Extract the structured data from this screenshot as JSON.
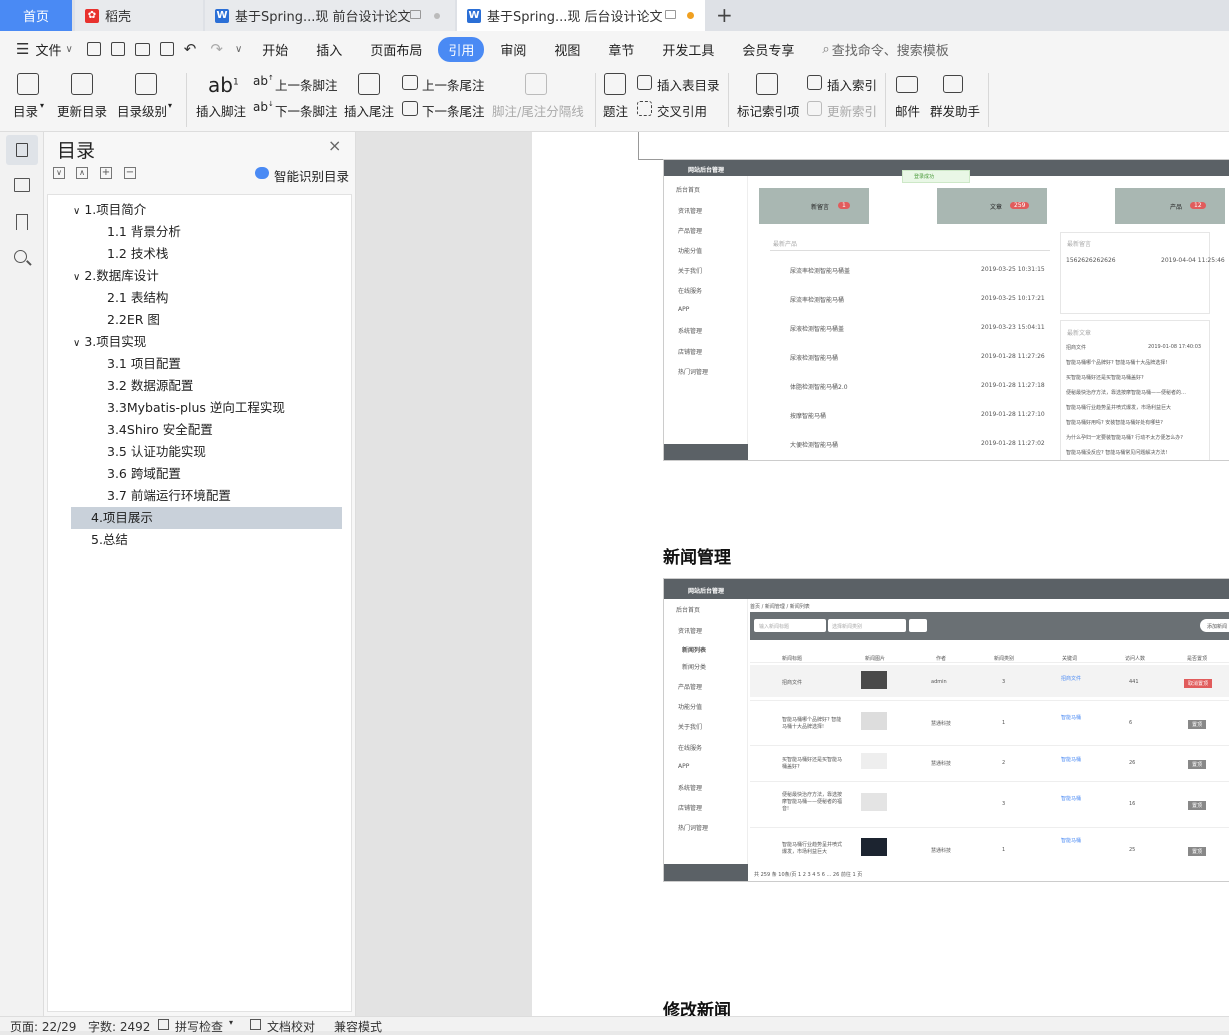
{
  "tabs": {
    "home": "首页",
    "daoke": "稻壳",
    "doc1": "基于Spring...现 前台设计论文",
    "doc2": "基于Spring...现 后台设计论文",
    "new_tab": "+"
  },
  "menu": {
    "file": "文件",
    "items": [
      "开始",
      "插入",
      "页面布局",
      "引用",
      "审阅",
      "视图",
      "章节",
      "开发工具",
      "会员专享"
    ],
    "active": "引用",
    "search": "查找命令、搜索模板"
  },
  "toolbar": {
    "toc": "目录",
    "update_toc": "更新目录",
    "toc_level": "目录级别",
    "insert_footnote": "插入脚注",
    "prev_footnote": "上一条脚注",
    "next_footnote": "下一条脚注",
    "insert_endnote": "插入尾注",
    "prev_endnote": "上一条尾注",
    "next_endnote": "下一条尾注",
    "separator": "脚注/尾注分隔线",
    "caption": "题注",
    "insert_table_toc": "插入表目录",
    "cross_ref": "交叉引用",
    "mark_index": "标记索引项",
    "insert_index": "插入索引",
    "update_index": "更新索引",
    "mail": "邮件",
    "mass_send": "群发助手"
  },
  "toc_panel": {
    "title": "目录",
    "smart": "智能识别目录",
    "items": [
      {
        "label": "1.项目简介",
        "level": 1
      },
      {
        "label": "1.1 背景分析",
        "level": 2
      },
      {
        "label": "1.2 技术栈",
        "level": 2
      },
      {
        "label": "2.数据库设计",
        "level": 1
      },
      {
        "label": "2.1 表结构",
        "level": 2
      },
      {
        "label": "2.2ER 图",
        "level": 2
      },
      {
        "label": "3.项目实现",
        "level": 1
      },
      {
        "label": "3.1 项目配置",
        "level": 2
      },
      {
        "label": "3.2 数据源配置",
        "level": 2
      },
      {
        "label": "3.3Mybatis-plus 逆向工程实现",
        "level": 2
      },
      {
        "label": "3.4Shiro 安全配置",
        "level": 2
      },
      {
        "label": "3.5 认证功能实现",
        "level": 2
      },
      {
        "label": "3.6 跨域配置",
        "level": 2
      },
      {
        "label": "3.7 前端运行环境配置",
        "level": 2
      },
      {
        "label": "4.项目展示",
        "level": 1
      },
      {
        "label": "5.总结",
        "level": 1
      }
    ],
    "selected": "4.项目展示"
  },
  "document": {
    "heading_news": "新闻管理",
    "heading_edit": "修改新闻",
    "shot1": {
      "brand": "网站后台管理",
      "toast": "登录成功",
      "cards": [
        {
          "label": "新留言",
          "count": "1"
        },
        {
          "label": "文章",
          "count": "259"
        },
        {
          "label": "产品",
          "count": "12"
        }
      ],
      "sidebar": [
        "后台首页",
        "资讯管理",
        "产品管理",
        "功能分值",
        "关于我们",
        "在线服务",
        "APP",
        "系统管理",
        "店铺管理",
        "热门词管理"
      ],
      "latest_products_title": "最新产品",
      "products": [
        {
          "name": "尿流率检测智能马桶盖",
          "time": "2019-03-25 10:31:15"
        },
        {
          "name": "尿流率检测智能马桶",
          "time": "2019-03-25 10:17:21"
        },
        {
          "name": "尿液检测智能马桶盖",
          "time": "2019-03-23 15:04:11"
        },
        {
          "name": "尿液检测智能马桶",
          "time": "2019-01-28 11:27:26"
        },
        {
          "name": "体脂检测智能马桶2.0",
          "time": "2019-01-28 11:27:18"
        },
        {
          "name": "按摩智能马桶",
          "time": "2019-01-28 11:27:10"
        },
        {
          "name": "大便检测智能马桶",
          "time": "2019-01-28 11:27:02"
        }
      ],
      "latest_msg_title": "最新留言",
      "msg": {
        "text": "1562626262626",
        "time": "2019-04-04 11:25:46"
      },
      "latest_article_title": "最新文章",
      "articles": [
        {
          "text": "招商文件",
          "time": "2019-01-08 17:40:03"
        },
        {
          "text": "智能马桶哪个品牌好? 智能马桶十大品牌选择!",
          "time": ""
        },
        {
          "text": "买智能马桶好还是买智能马桶盖好?",
          "time": ""
        },
        {
          "text": "便秘最快治疗方法，靠选按摩智能马桶——便秘者的…",
          "time": ""
        },
        {
          "text": "智能马桶行业趋势呈井喷式爆发，市场利益巨大",
          "time": ""
        },
        {
          "text": "智能马桶好用吗? 安装智能马桶好处有哪些?",
          "time": ""
        },
        {
          "text": "为什么孕妇一定要装智能马桶? 行动不太方便怎么办?",
          "time": ""
        },
        {
          "text": "智能马桶没反应? 智能马桶常见问题解决方法!",
          "time": ""
        }
      ]
    },
    "shot2": {
      "brand": "网站后台管理",
      "breadcrumb": "首页 / 新闻管理 / 新闻列表",
      "search_ph1": "输入新闻标题",
      "search_ph2": "选择新闻类别",
      "add_btn": "添加新闻",
      "sidebar": [
        "后台首页",
        "资讯管理",
        "新闻列表",
        "新闻分类",
        "产品管理",
        "功能分值",
        "关于我们",
        "在线服务",
        "APP",
        "系统管理",
        "店铺管理",
        "热门词管理"
      ],
      "columns": [
        "新闻标题",
        "新闻图片",
        "作者",
        "新闻类别",
        "关键词",
        "访问人数",
        "是否置顶"
      ],
      "rows": [
        {
          "title": "招商文件",
          "author": "admin",
          "cat": "3",
          "kw": "招商文件",
          "views": "441",
          "btn": "取消置顶"
        },
        {
          "title": "智能马桶哪个品牌好? 智能马桶十大品牌选择!",
          "author": "慧通科技",
          "cat": "1",
          "kw": "智能马桶",
          "views": "6",
          "btn": "置顶"
        },
        {
          "title": "买智能马桶好还是买智能马桶盖好?",
          "author": "慧通科技",
          "cat": "2",
          "kw": "智能马桶",
          "views": "26",
          "btn": "置顶"
        },
        {
          "title": "便秘最快治疗方法，靠选按摩智能马桶——便秘者的福音!",
          "author": "",
          "cat": "3",
          "kw": "智能马桶",
          "views": "16",
          "btn": "置顶"
        },
        {
          "title": "智能马桶行业趋势呈井喷式爆发，市场利益巨大",
          "author": "慧通科技",
          "cat": "1",
          "kw": "智能马桶",
          "views": "25",
          "btn": "置顶"
        }
      ],
      "pager": "共 259 条   10条/页   1 2 3 4 5 6 ... 26   前往 1 页"
    }
  },
  "status": {
    "page": "页面: 22/29",
    "words": "字数: 2492",
    "spell": "拼写检查",
    "proof": "文档校对",
    "compat": "兼容模式"
  },
  "colors": {
    "accent": "#4a8af4",
    "tab_active": "#ffffff",
    "selected_toc": "#c9d1da"
  }
}
